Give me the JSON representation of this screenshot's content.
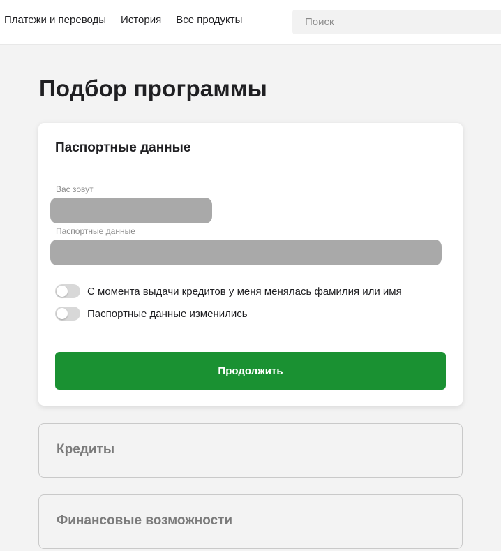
{
  "nav": {
    "items": [
      {
        "label": "Платежи и переводы"
      },
      {
        "label": "История"
      },
      {
        "label": "Все продукты"
      }
    ],
    "search_placeholder": "Поиск"
  },
  "page": {
    "title": "Подбор программы"
  },
  "passport_card": {
    "title": "Паспортные данные",
    "fields": [
      {
        "label": "Вас зовут",
        "value": ""
      },
      {
        "label": "Паспортные данные",
        "value": ""
      }
    ],
    "toggles": [
      {
        "label": "С момента выдачи кредитов у меня менялась фамилия или имя",
        "checked": false
      },
      {
        "label": "Паспортные данные изменились",
        "checked": false
      }
    ],
    "continue_label": "Продолжить"
  },
  "sections": [
    {
      "title": "Кредиты"
    },
    {
      "title": "Финансовые возможности"
    }
  ],
  "colors": {
    "primary_button": "#1a9132",
    "field_redacted": "#a9a9a9",
    "page_background": "#f3f3f3"
  }
}
